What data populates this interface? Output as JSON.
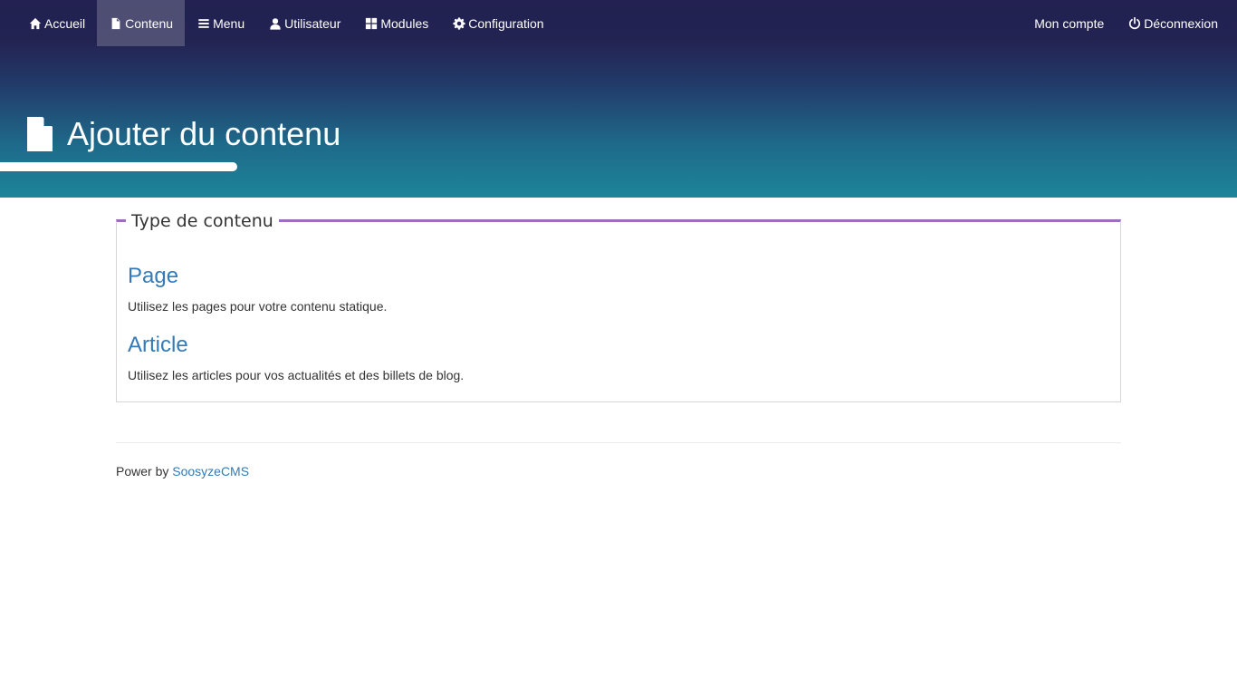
{
  "nav": {
    "left": [
      {
        "label": "Accueil",
        "icon": "home-icon"
      },
      {
        "label": "Contenu",
        "icon": "file-icon",
        "active": true
      },
      {
        "label": "Menu",
        "icon": "bars-icon"
      },
      {
        "label": "Utilisateur",
        "icon": "user-icon"
      },
      {
        "label": "Modules",
        "icon": "th-large-icon"
      },
      {
        "label": "Configuration",
        "icon": "gear-icon"
      }
    ],
    "right": [
      {
        "label": "Mon compte"
      },
      {
        "label": "Déconnexion",
        "icon": "power-icon"
      }
    ]
  },
  "header": {
    "title": "Ajouter du contenu",
    "icon": "file-icon"
  },
  "content_types": {
    "legend": "Type de contenu",
    "items": [
      {
        "title": "Page",
        "description": "Utilisez les pages pour votre contenu statique."
      },
      {
        "title": "Article",
        "description": "Utilisez les articles pour vos actualités et des billets de blog."
      }
    ]
  },
  "footer": {
    "prefix": "Power by",
    "link_label": "SoosyzeCMS"
  },
  "colors": {
    "header_gradient_top": "#222151",
    "header_gradient_bottom": "#1d8599",
    "legend_accent": "#9b6fbe",
    "link": "#337ab7"
  }
}
